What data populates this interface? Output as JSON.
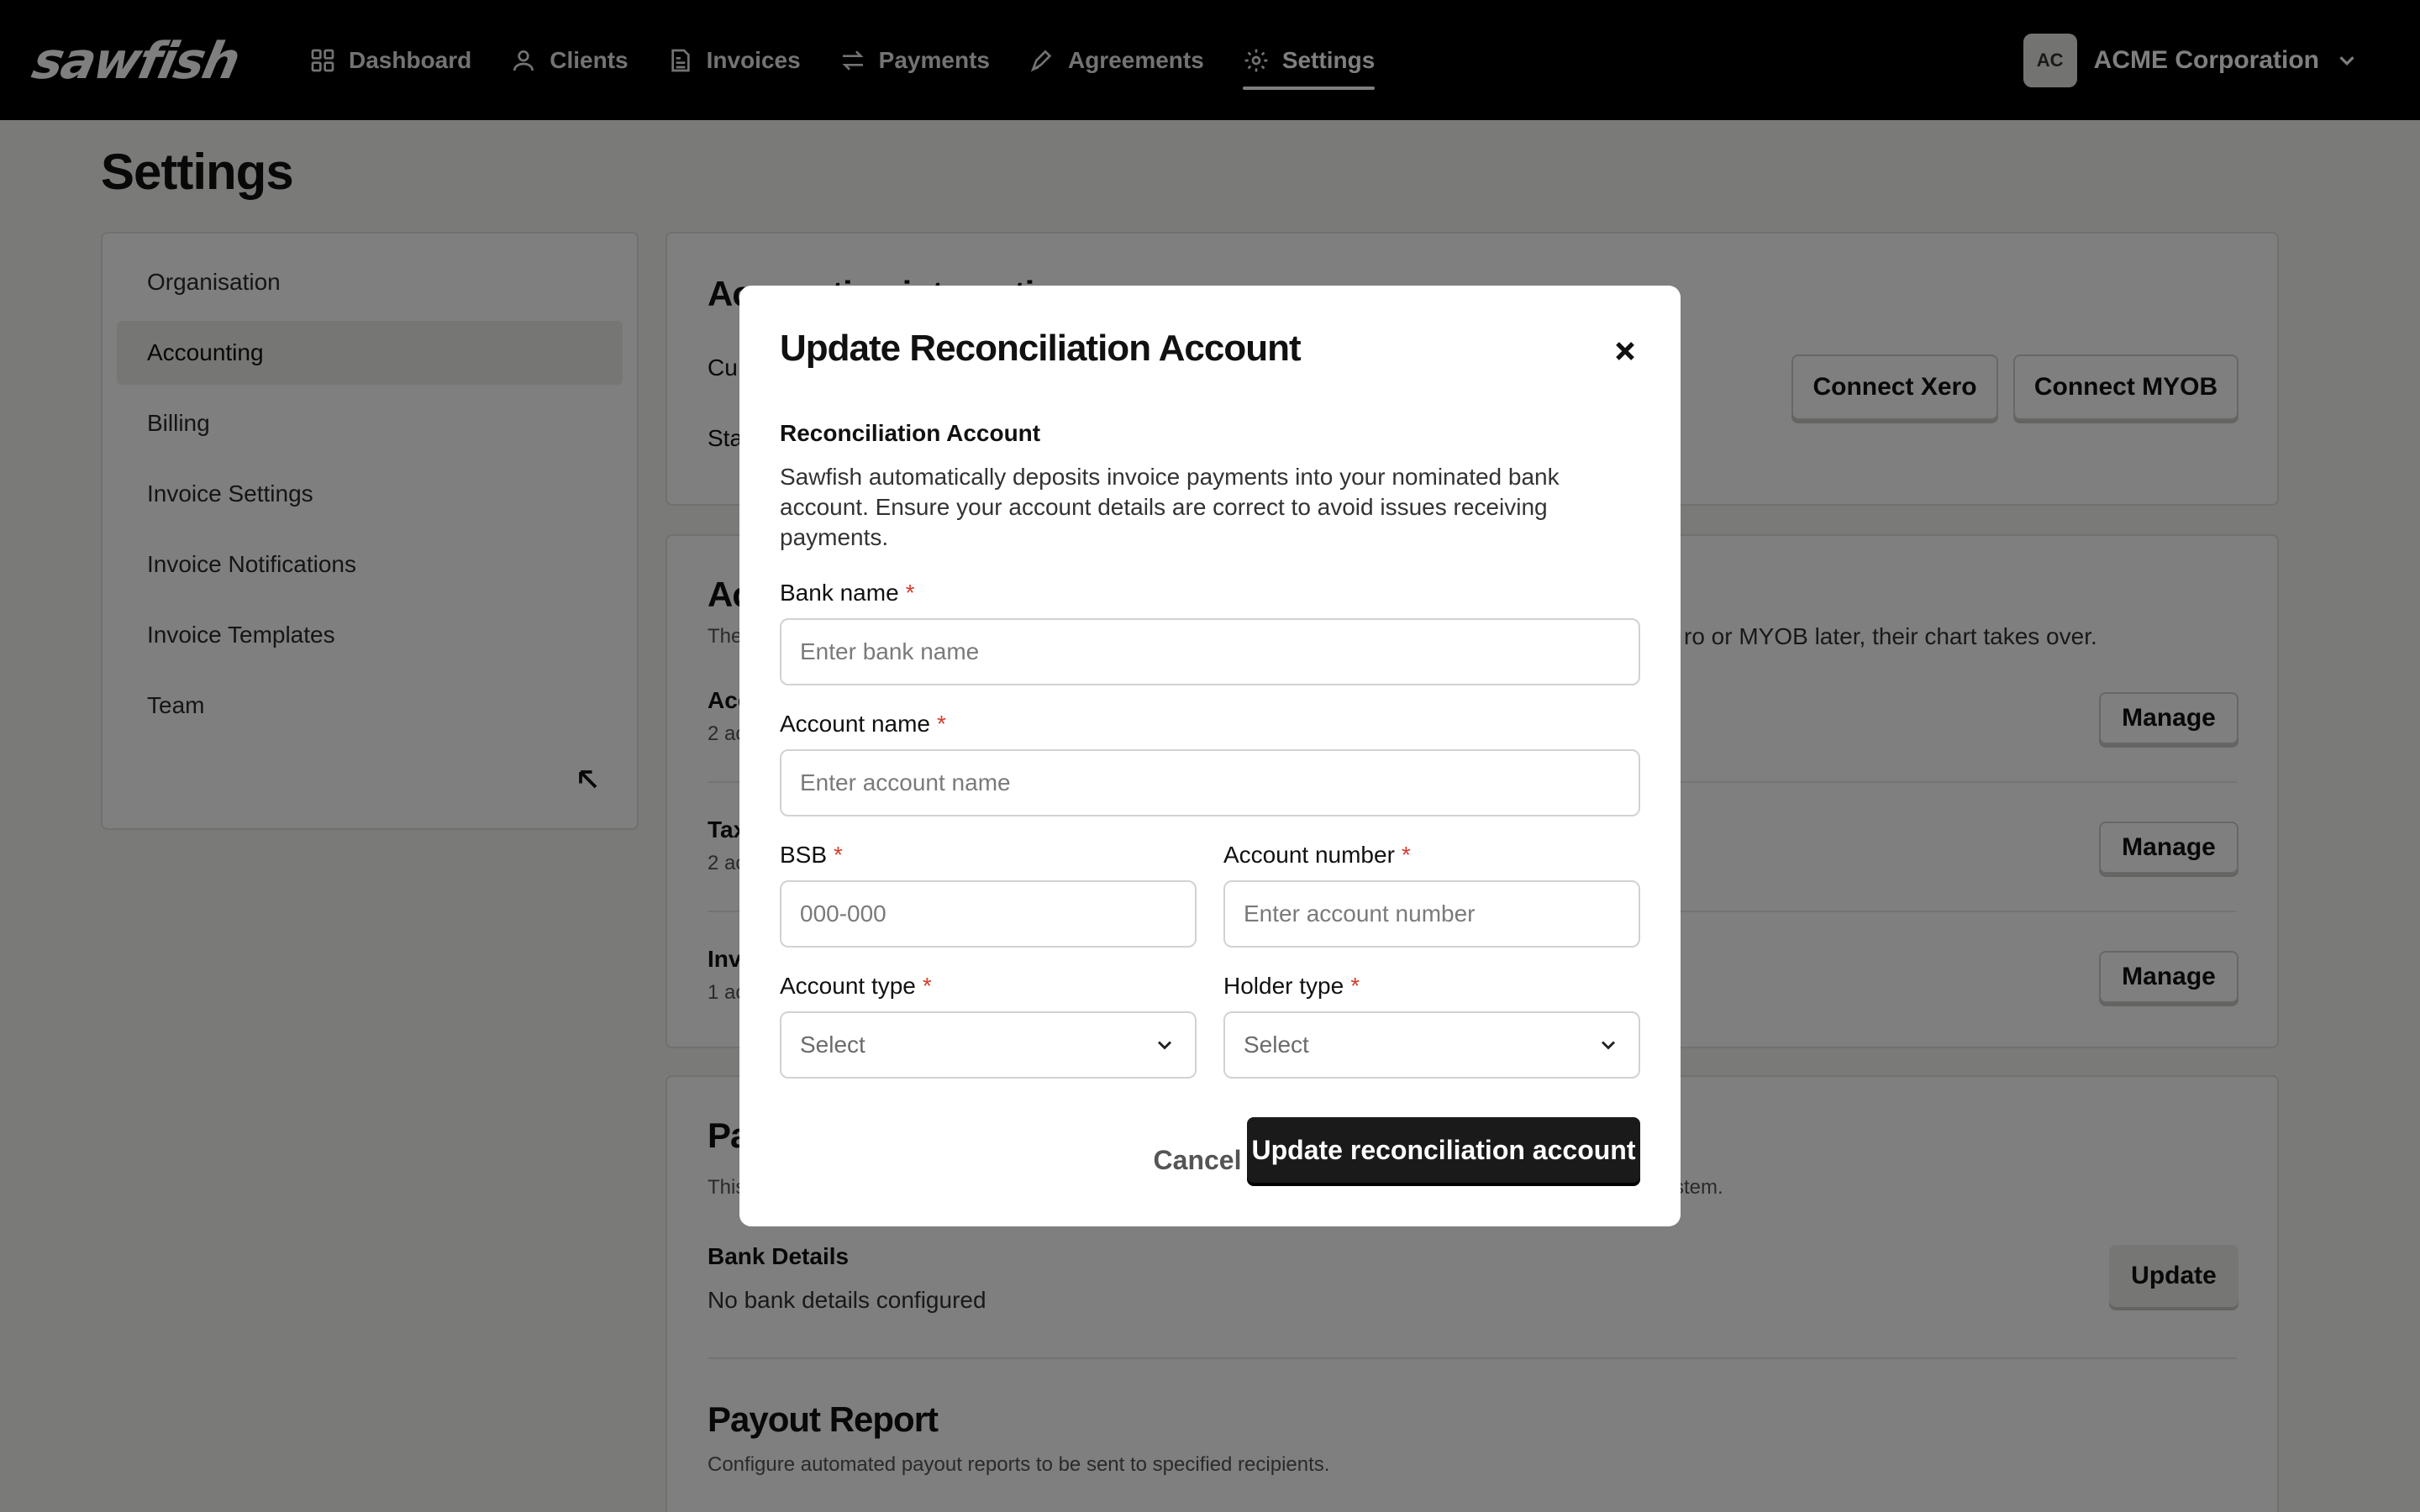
{
  "app": {
    "logo_text": "sawfish"
  },
  "nav": {
    "items": [
      {
        "label": "Dashboard",
        "icon": "grid-icon"
      },
      {
        "label": "Clients",
        "icon": "user-icon"
      },
      {
        "label": "Invoices",
        "icon": "invoice-icon"
      },
      {
        "label": "Payments",
        "icon": "transfer-arrows-icon"
      },
      {
        "label": "Agreements",
        "icon": "signature-pen-icon"
      },
      {
        "label": "Settings",
        "icon": "gear-icon",
        "active": true
      }
    ]
  },
  "org": {
    "initials": "AC",
    "name": "ACME Corporation"
  },
  "page": {
    "title": "Settings"
  },
  "sidebar": {
    "items": [
      {
        "label": "Organisation"
      },
      {
        "label": "Accounting",
        "active": true
      },
      {
        "label": "Billing"
      },
      {
        "label": "Invoice Settings"
      },
      {
        "label": "Invoice Notifications"
      },
      {
        "label": "Invoice Templates"
      },
      {
        "label": "Team"
      }
    ]
  },
  "background": {
    "integration": {
      "title_partial": "Accounting integration",
      "row1_prefix": "Cu",
      "row2_prefix": "Sta",
      "connect_xero": "Connect Xero",
      "connect_myob": "Connect MYOB"
    },
    "accounts": {
      "title_partial": "Ac",
      "desc_prefix": "The",
      "desc_suffix": "ro or MYOB later, their chart takes over.",
      "rows": [
        {
          "title_prefix": "Acc",
          "sub_prefix": "2 ac",
          "button": "Manage"
        },
        {
          "title_prefix": "Tax",
          "sub_prefix": "2 ac",
          "button": "Manage"
        },
        {
          "title_prefix": "Inv",
          "sub_prefix": "1 ac",
          "button": "Manage"
        }
      ]
    },
    "payouts": {
      "title_partial": "Pa",
      "desc_prefix": "This",
      "desc_suffix": "stem.",
      "bank_title": "Bank Details",
      "bank_value": "No bank details configured",
      "update_button": "Update",
      "report_title": "Payout Report",
      "report_desc": "Configure automated payout reports to be sent to specified recipients."
    }
  },
  "modal": {
    "title": "Update Reconciliation Account",
    "section_label": "Reconciliation Account",
    "section_desc": "Sawfish automatically deposits invoice payments into your nominated bank account. Ensure your account details are correct to avoid issues receiving payments.",
    "required_mark": "*",
    "bank_name": {
      "label": "Bank name",
      "placeholder": "Enter bank name",
      "value": ""
    },
    "account_name": {
      "label": "Account name",
      "placeholder": "Enter account name",
      "value": ""
    },
    "bsb": {
      "label": "BSB",
      "placeholder": "000-000",
      "value": ""
    },
    "account_number": {
      "label": "Account number",
      "placeholder": "Enter account number",
      "value": ""
    },
    "account_type": {
      "label": "Account type",
      "selected": "Select"
    },
    "holder_type": {
      "label": "Holder type",
      "selected": "Select"
    },
    "cancel": "Cancel",
    "submit": "Update reconciliation account"
  }
}
